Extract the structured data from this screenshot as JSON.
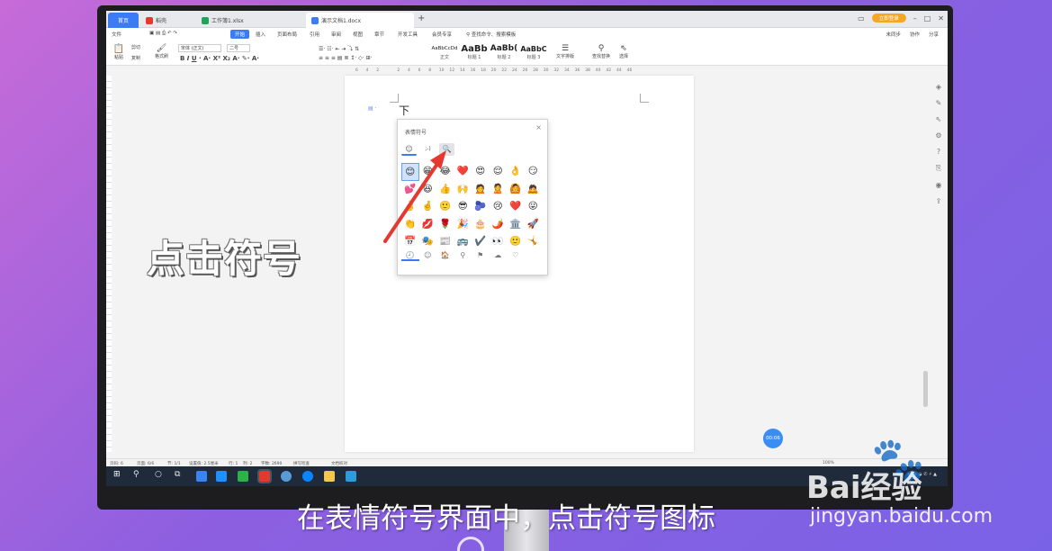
{
  "tabs": {
    "home": "首页",
    "wps": "稻壳",
    "xlsx": "工作簿1.xlsx",
    "docx": "演示文档1.docx",
    "add": "+"
  },
  "window": {
    "login": "立即登录"
  },
  "menu": {
    "file": "文件",
    "start": "开始",
    "insert": "插入",
    "layout": "页面布局",
    "ref": "引用",
    "review": "审阅",
    "view": "视图",
    "chapter": "章节",
    "dev": "开发工具",
    "member": "会员专享",
    "search": "查找命令、搜索模板",
    "sync": "未同步",
    "collab": "协作",
    "share": "分享"
  },
  "ribbon": {
    "paste": "粘贴",
    "cut": "剪切",
    "copy": "复制",
    "format_painter": "格式刷",
    "font": "宋体 (正文)",
    "size": "二号",
    "styles": [
      {
        "preview": "AaBbCcDd",
        "name": "正文"
      },
      {
        "preview": "AaBb",
        "name": "标题 1"
      },
      {
        "preview": "AaBb(",
        "name": "标题 2"
      },
      {
        "preview": "AaBbC",
        "name": "标题 3"
      }
    ],
    "text_layout": "文字排版",
    "find_replace": "查找替换",
    "select": "选择"
  },
  "ruler_marks": [
    "6",
    "4",
    "2",
    "",
    "2",
    "4",
    "6",
    "8",
    "10",
    "12",
    "14",
    "16",
    "18",
    "20",
    "22",
    "24",
    "26",
    "28",
    "30",
    "32",
    "34",
    "36",
    "38",
    "40",
    "42",
    "44",
    "46"
  ],
  "doc": {
    "text": "下"
  },
  "emoji_panel": {
    "title": "表情符号",
    "close": "×",
    "tabs": [
      "☺",
      ";-)",
      "🔍"
    ],
    "rows": [
      [
        "😊",
        "😁",
        "😂",
        "❤️",
        "😍",
        "😌",
        "👌",
        "😏"
      ],
      [
        "💕",
        "😆",
        "👍",
        "🙌",
        "🙍",
        "🙎",
        "🙆",
        "🙇"
      ],
      [
        "✌️",
        "🤞",
        "🙂",
        "😎",
        "🫐",
        "😢",
        "❤️",
        "😜"
      ],
      [
        "👏",
        "💋",
        "🌹",
        "🎉",
        "🎂",
        "🌶️",
        "🏛️",
        "🚀"
      ],
      [
        "📅",
        "🎭",
        "📰",
        "🚌",
        "✔️",
        "👀",
        "🙂",
        "🤸"
      ]
    ],
    "bottom": [
      "🕘",
      "☺",
      "🏠",
      "⚲",
      "⚑",
      "☁",
      "♡"
    ]
  },
  "timer": "00:06",
  "status": {
    "page": "页码: 6",
    "pages": "页面: 6/6",
    "section": "节: 1/1",
    "setting": "设置值: 2.5厘米",
    "row": "行: 1",
    "col": "列: 2",
    "words": "字数: 2690",
    "spell": "拼写检查",
    "proof": "文档校对",
    "zoom": "100%"
  },
  "overlay": {
    "caption": "点击符号",
    "subtitle": "在表情符号界面中，点击符号图标",
    "brand": "Bai经验",
    "paw": "🐾",
    "url": "jingyan.baidu.com"
  },
  "colors": {
    "accent": "#3b7cf4",
    "arrow": "#e5382f",
    "taskbar": "#1f2a3a"
  }
}
